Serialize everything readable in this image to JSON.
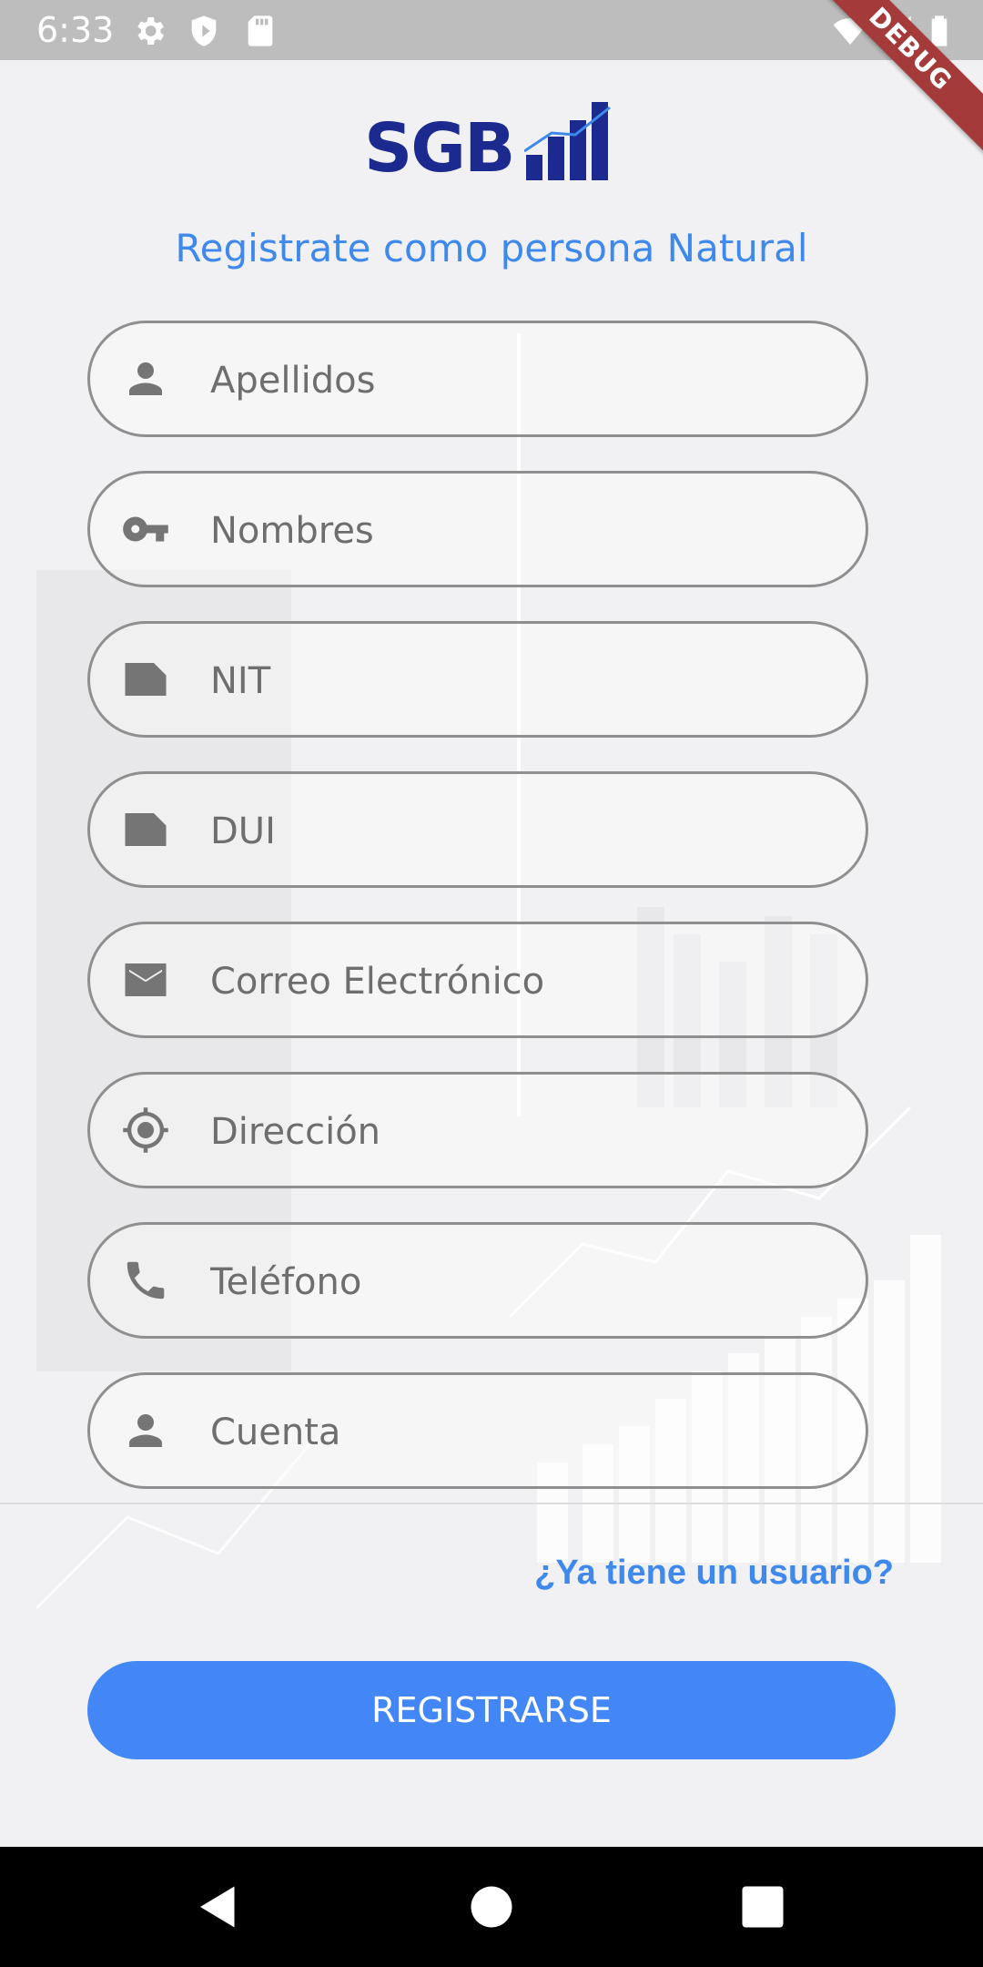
{
  "status_bar": {
    "time": "6:33",
    "debug_label": "DEBUG"
  },
  "logo": {
    "text": "SGB"
  },
  "page": {
    "title": "Registrate como persona Natural"
  },
  "form": {
    "fields": [
      {
        "placeholder": "Apellidos",
        "icon": "person-icon"
      },
      {
        "placeholder": "Nombres",
        "icon": "key-icon"
      },
      {
        "placeholder": "NIT",
        "icon": "card-icon"
      },
      {
        "placeholder": "DUI",
        "icon": "card-icon"
      },
      {
        "placeholder": "Correo Electrónico",
        "icon": "mail-icon"
      },
      {
        "placeholder": "Dirección",
        "icon": "location-icon"
      },
      {
        "placeholder": "Teléfono",
        "icon": "phone-icon"
      },
      {
        "placeholder": "Cuenta",
        "icon": "person-icon"
      }
    ]
  },
  "links": {
    "login": "¿Ya tiene un usuario?"
  },
  "buttons": {
    "register": "REGISTRARSE"
  },
  "colors": {
    "accent": "#4387f7",
    "link": "#3f88ec",
    "logo": "#1c2a8f",
    "border": "#8f8f8f"
  }
}
